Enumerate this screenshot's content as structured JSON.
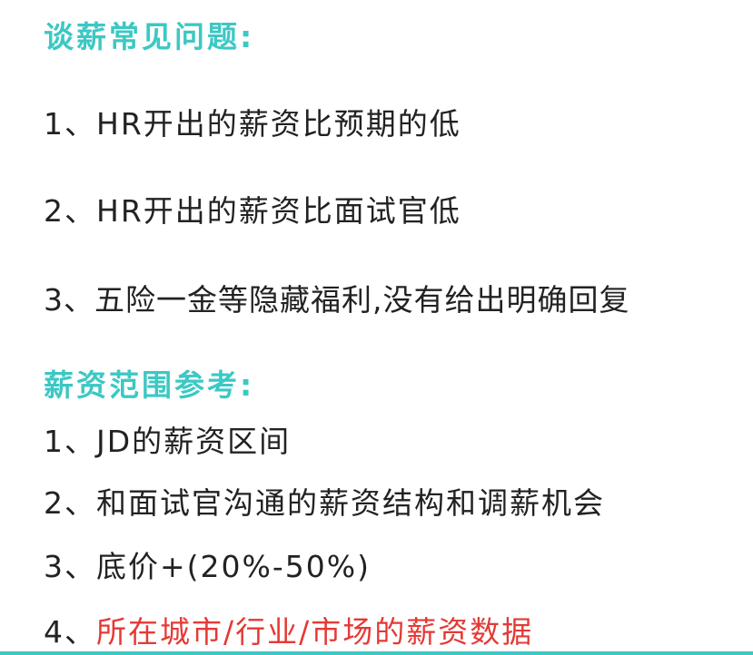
{
  "section1": {
    "heading": "谈薪常见问题:",
    "items": [
      {
        "num": "1、",
        "text": "HR开出的薪资比预期的低"
      },
      {
        "num": "2、",
        "text": "HR开出的薪资比面试官低"
      },
      {
        "num": "3、",
        "text": "五险一金等隐藏福利,没有给出明确回复"
      }
    ]
  },
  "section2": {
    "heading": "薪资范围参考:",
    "items": [
      {
        "num": "1、",
        "text": "JD的薪资区间"
      },
      {
        "num": "2、",
        "text": "和面试官沟通的薪资结构和调薪机会"
      },
      {
        "num": "3、",
        "text": "底价+(20%-50%)"
      },
      {
        "num": "4、",
        "text": "所在城市/行业/市场的薪资数据"
      }
    ]
  },
  "colors": {
    "heading": "#3cc8c4",
    "highlight": "#e53935",
    "text": "#222222"
  }
}
